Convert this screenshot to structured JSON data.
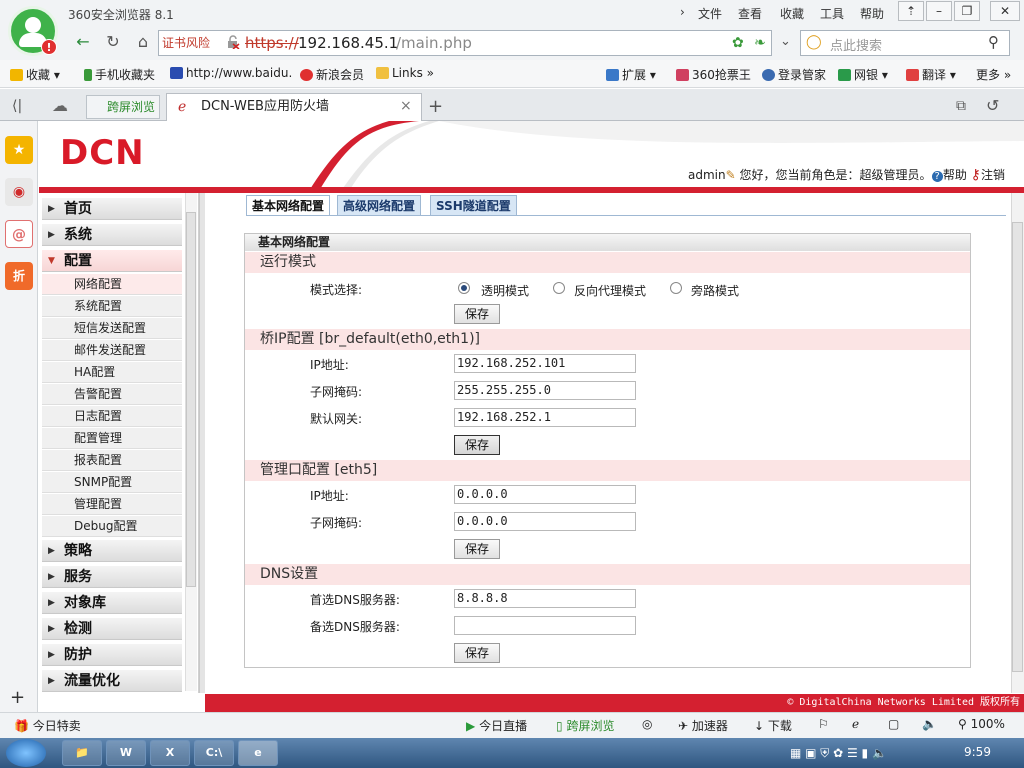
{
  "browser": {
    "title": "360安全浏览器 8.1",
    "menus": [
      "文件",
      "查看",
      "收藏",
      "工具",
      "帮助"
    ],
    "cert_warning": "证书风险",
    "url_protocol": "https://",
    "url_host": "192.168.45.1",
    "url_path": "/main.php",
    "search_placeholder": "点此搜索",
    "bookmarks": [
      "收藏",
      "手机收藏夹",
      "http://www.baidu.",
      "新浪会员",
      "Links"
    ],
    "toolbar_right": [
      "扩展",
      "360抢票王",
      "登录管家",
      "网银",
      "翻译",
      "更多"
    ],
    "tabs": {
      "crossscreen": "跨屏浏览",
      "active": "DCN-WEB应用防火墙"
    },
    "status_left": "今日特卖",
    "status_right": [
      "今日直播",
      "跨屏浏览",
      "加速器",
      "下载",
      "100%"
    ]
  },
  "app": {
    "logo": "DCN",
    "user": "admin",
    "greeting": "您好，您当前角色是：超级管理员。",
    "help": "帮助",
    "logout": "注销",
    "copyright": "© DigitalChina Networks Limited 版权所有"
  },
  "nav": {
    "top1": [
      "首页",
      "系统"
    ],
    "config": "配置",
    "sub": [
      "网络配置",
      "系统配置",
      "短信发送配置",
      "邮件发送配置",
      "HA配置",
      "告警配置",
      "日志配置",
      "配置管理",
      "报表配置",
      "SNMP配置",
      "管理配置",
      "Debug配置"
    ],
    "top2": [
      "策略",
      "服务",
      "对象库",
      "检测",
      "防护",
      "流量优化"
    ]
  },
  "content": {
    "tabs": [
      "基本网络配置",
      "高级网络配置",
      "SSH隧道配置"
    ],
    "panel_title": "基本网络配置",
    "mode_section": "运行模式",
    "mode_label": "模式选择:",
    "modes": [
      "透明模式",
      "反向代理模式",
      "旁路模式"
    ],
    "selected_mode": "透明模式",
    "bridge_section": "桥IP配置  [br_default(eth0,eth1)]",
    "bridge": {
      "ip_label": "IP地址:",
      "ip": "192.168.252.101",
      "mask_label": "子网掩码:",
      "mask": "255.255.255.0",
      "gw_label": "默认网关:",
      "gw": "192.168.252.1"
    },
    "mgmt_section": "管理口配置  [eth5]",
    "mgmt": {
      "ip_label": "IP地址:",
      "ip": "0.0.0.0",
      "mask_label": "子网掩码:",
      "mask": "0.0.0.0"
    },
    "dns_section": "DNS设置",
    "dns": {
      "primary_label": "首选DNS服务器:",
      "primary": "8.8.8.8",
      "secondary_label": "备选DNS服务器:",
      "secondary": ""
    },
    "save": "保存"
  },
  "taskbar": {
    "clock": "9:59"
  }
}
